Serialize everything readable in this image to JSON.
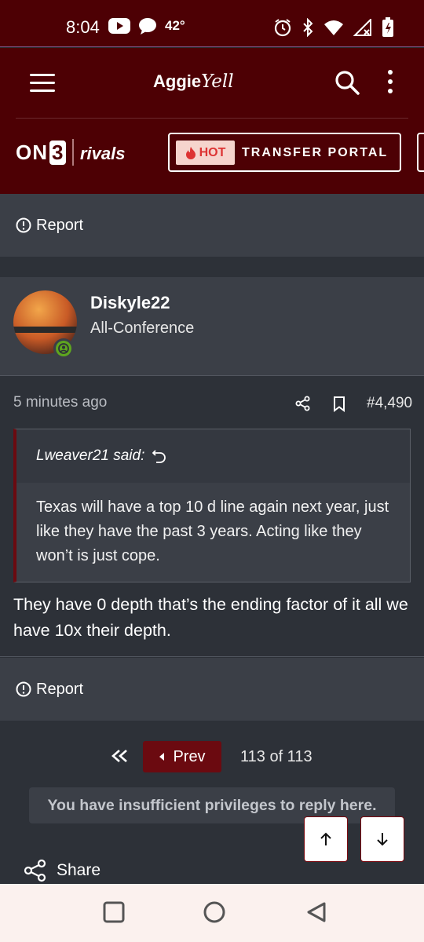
{
  "status_bar": {
    "time": "8:04",
    "temperature": "42°",
    "icons_left": [
      "youtube-icon",
      "message-icon"
    ],
    "icons_right": [
      "alarm-icon",
      "bluetooth-icon",
      "wifi-icon",
      "signal-icon",
      "battery-icon"
    ]
  },
  "header": {
    "brand_main": "Aggie",
    "brand_script": "Yell"
  },
  "brand_bar": {
    "on3": "ON",
    "on3_digit": "3",
    "rivals": "rivals",
    "hot_badge": "HOT",
    "hot_link": "TRANSFER PORTAL"
  },
  "report_label": "Report",
  "post": {
    "username": "Diskyle22",
    "user_title": "All-Conference",
    "time": "5 minutes ago",
    "number": "#4,490",
    "quote_author": "Lweaver21 said:",
    "quote_text": "Texas will have a top 10 d line again next year, just like they have the past 3 years. Acting like they won’t is just cope.",
    "body": "They have 0 depth that’s the ending factor of it all we have 10x their depth."
  },
  "pagination": {
    "prev_label": "Prev",
    "status": "113 of 113"
  },
  "no_reply_notice": "You have insufficient privileges to reply here.",
  "share_label": "Share",
  "colors": {
    "brand_maroon": "#4d0004",
    "accent_maroon": "#6b0a10",
    "panel": "#3b3f47",
    "background": "#2d3138",
    "online_green": "#5ea61f"
  }
}
